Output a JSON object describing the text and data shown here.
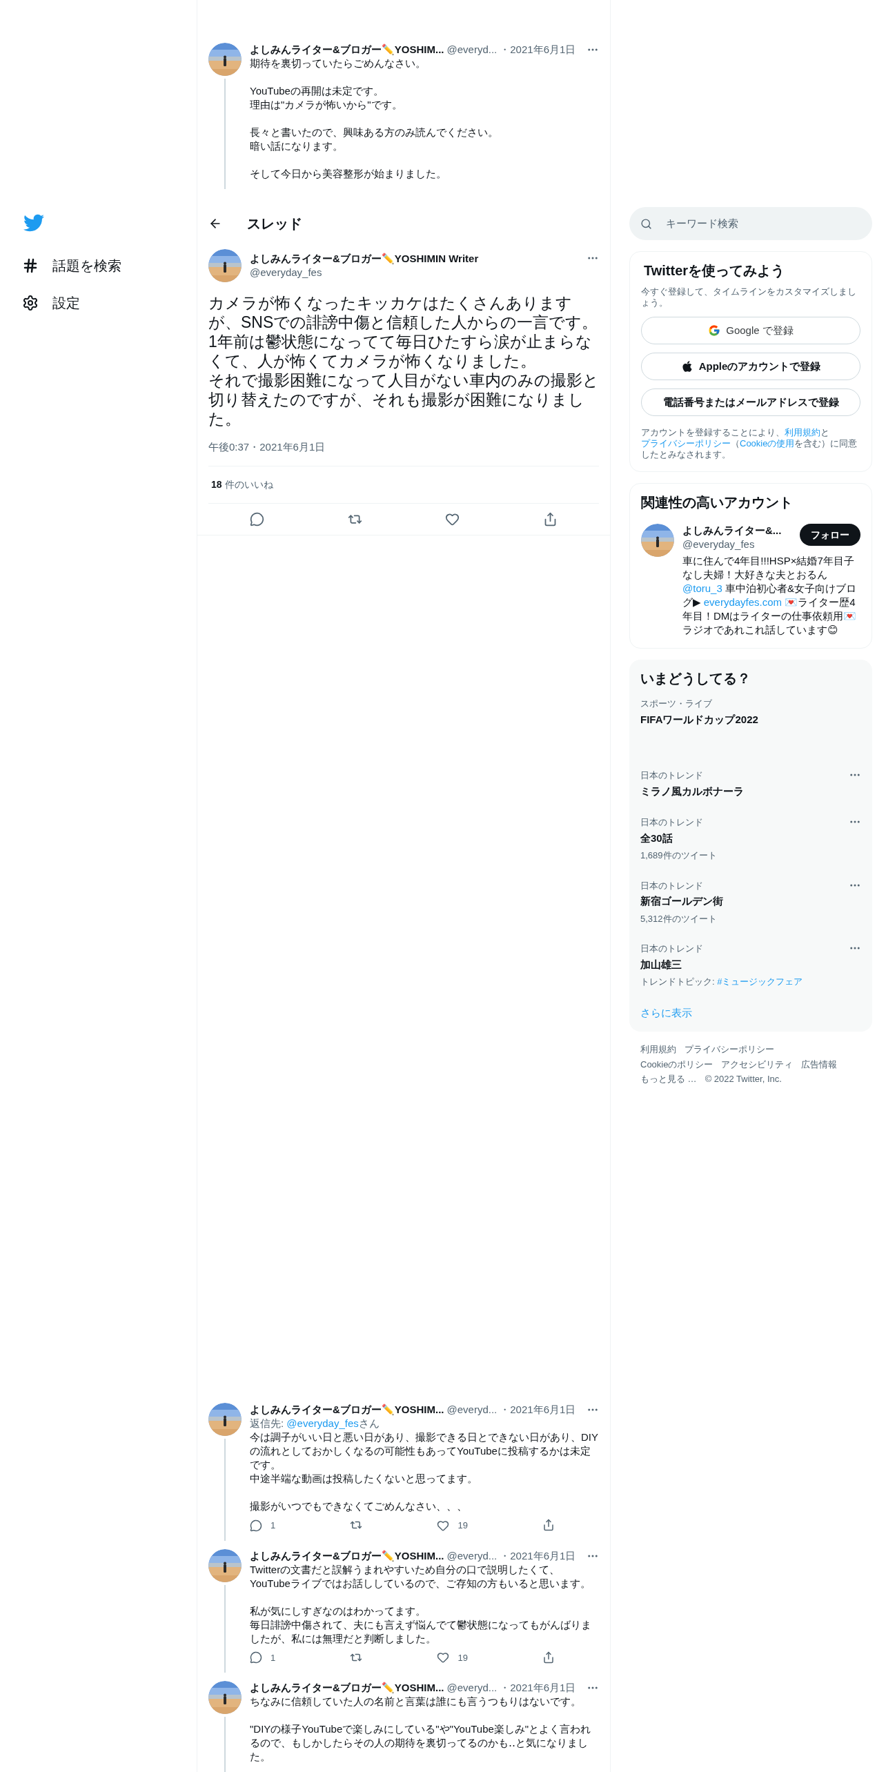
{
  "sidebar": {
    "items": [
      {
        "kind": "explore",
        "label": "話題を検索"
      },
      {
        "kind": "settings",
        "label": "設定"
      }
    ]
  },
  "thread_above": {
    "name": "よしみんライター&ブロガー✏️YOSHIM...",
    "handle": "@everyd...",
    "date": "・2021年6月1日",
    "paragraphs": [
      [
        "期待を裏切っていたらごめんなさい。"
      ],
      [
        "YouTubeの再開は未定です。",
        "理由は\"カメラが怖いから\"です。"
      ],
      [
        "長々と書いたので、興味ある方のみ読んでください。",
        "暗い話になります。"
      ],
      [
        "そして今日から美容整形が始まりました。"
      ]
    ]
  },
  "header": {
    "title": "スレッド"
  },
  "main_tweet": {
    "name": "よしみんライター&ブロガー✏️YOSHIMIN Writer",
    "handle": "@everyday_fes",
    "paragraphs": [
      [
        "カメラが怖くなったキッカケはたくさんありますが、SNSでの誹謗中傷と信頼した人からの一言です。",
        "1年前は鬱状態になってて毎日ひたすら涙が止まらなくて、人が怖くてカメラが怖くなりました。",
        "それで撮影困難になって人目がない車内のみの撮影と切り替えたのですが、それも撮影が困難になりました。"
      ]
    ],
    "timestamp": "午後0:37・2021年6月1日",
    "like_count": "18",
    "like_label": "件のいいね"
  },
  "replies": [
    {
      "name": "よしみんライター&ブロガー✏️YOSHIM...",
      "handle": "@everyd...",
      "date": "・2021年6月1日",
      "reply_to": {
        "label": "返信先: ",
        "handle": "@everyday_fes",
        "suffix": "さん"
      },
      "paragraphs": [
        [
          "今は調子がいい日と悪い日があり、撮影できる日とできない日があり、DIYの流れとしておかしくなるの可能性もあってYouTubeに投稿するかは未定です。",
          "中途半端な動画は投稿したくないと思ってます。"
        ],
        [
          "撮影がいつでもできなくてごめんなさい、、、"
        ]
      ],
      "reply_count": "1",
      "like_count": "19"
    },
    {
      "name": "よしみんライター&ブロガー✏️YOSHIM...",
      "handle": "@everyd...",
      "date": "・2021年6月1日",
      "paragraphs": [
        [
          "Twitterの文書だと誤解うまれやすいため自分の口で説明したくて、YouTubeライブではお話ししているので、ご存知の方もいると思います。"
        ],
        [
          "私が気にしすぎなのはわかってます。",
          "毎日誹謗中傷されて、夫にも言えず悩んでて鬱状態になってもがんばりましたが、私には無理だと判断しました。"
        ]
      ],
      "reply_count": "1",
      "like_count": "19"
    },
    {
      "name": "よしみんライター&ブロガー✏️YOSHIM...",
      "handle": "@everyd...",
      "date": "・2021年6月1日",
      "paragraphs": [
        [
          "ちなみに信頼していた人の名前と言葉は誰にも言うつもりはないです。"
        ],
        [
          "\"DIYの様子YouTubeで楽しみにしている\"や\"YouTube楽しみ\"とよく言われるので、もしかしたらその人の期待を裏切ってるのかも‥と気になりました。"
        ]
      ]
    }
  ],
  "search": {
    "placeholder": "キーワード検索"
  },
  "signup": {
    "title": "Twitterを使ってみよう",
    "subtitle": "今すぐ登録して、タイムラインをカスタマイズしましょう。",
    "buttons": [
      {
        "kind": "google",
        "label": "Google で登録"
      },
      {
        "kind": "apple",
        "label": "Appleのアカウントで登録"
      },
      {
        "kind": "plain",
        "label": "電話番号またはメールアドレスで登録"
      }
    ],
    "legal": [
      {
        "text": "アカウントを登録することにより、",
        "link": false
      },
      {
        "text": "利用規約",
        "link": true
      },
      {
        "text": "と",
        "link": false
      },
      {
        "text": "プライバシーポリシー",
        "link": true
      },
      {
        "text": "（",
        "link": false
      },
      {
        "text": "Cookieの使用",
        "link": true
      },
      {
        "text": "を含む）に同意したとみなされます。",
        "link": false
      }
    ]
  },
  "related": {
    "title": "関連性の高いアカウント",
    "name": "よしみんライター&...",
    "handle": "@everyday_fes",
    "follow_label": "フォロー",
    "bio": [
      {
        "text": "車に住んで4年目!!!HSP×結婚7年目子なし夫婦！大好きな夫とおるん ",
        "link": false
      },
      {
        "text": "@toru_3",
        "link": true
      },
      {
        "text": " 車中泊初心者&女子向けブログ▶ ",
        "link": false
      },
      {
        "text": "everydayfes.com",
        "link": true
      },
      {
        "text": " 💌ライター歴4年目！DMはライターの仕事依頼用💌ラジオであれこれ話しています😊",
        "link": false
      }
    ]
  },
  "trends": {
    "title": "いまどうしてる？",
    "items": [
      {
        "category": "スポーツ・ライブ",
        "title": "FIFAワールドカップ2022",
        "menu": false
      },
      {
        "category": "日本のトレンド",
        "title": "ミラノ風カルボナーラ",
        "menu": true
      },
      {
        "category": "日本のトレンド",
        "title": "全30話",
        "count": "1,689件のツイート",
        "menu": true
      },
      {
        "category": "日本のトレンド",
        "title": "新宿ゴールデン街",
        "count": "5,312件のツイート",
        "menu": true
      },
      {
        "category": "日本のトレンド",
        "title": "加山雄三",
        "topic_label": "トレンドトピック: ",
        "topic": "#ミュージックフェア",
        "menu": true
      }
    ],
    "show_more": "さらに表示"
  },
  "footer": {
    "links": [
      "利用規約",
      "プライバシーポリシー",
      "Cookieのポリシー",
      "アクセシビリティ",
      "広告情報",
      "もっと見る …"
    ],
    "copyright": "© 2022 Twitter, Inc."
  }
}
